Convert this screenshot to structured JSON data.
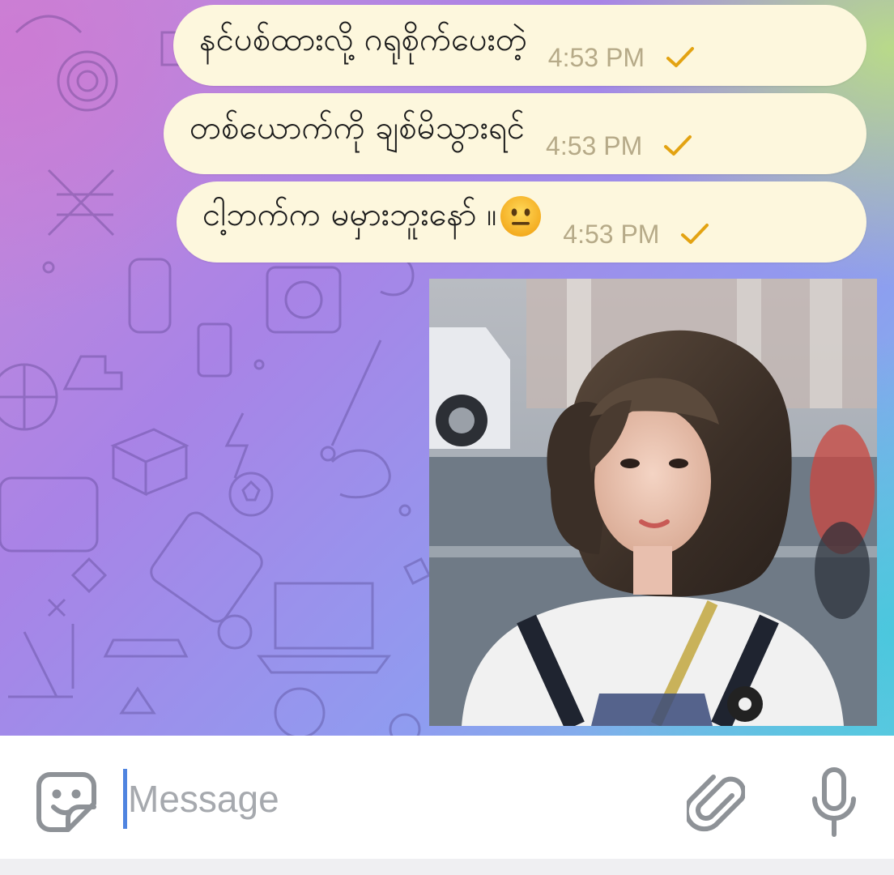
{
  "messages": [
    {
      "text": "နင်ပစ်ထားလို့ ဂရုစိုက်ပေးတဲ့",
      "time": "4:53 PM",
      "status_icon": "check-icon",
      "emoji": ""
    },
    {
      "text": "တစ်ယောက်ကို ချစ်မိသွားရင်",
      "time": "4:53 PM",
      "status_icon": "check-icon",
      "emoji": ""
    },
    {
      "text": "ငါ့ဘက်က မမှားဘူးနော် ။",
      "time": "4:53 PM",
      "status_icon": "check-icon",
      "emoji": "neutral-face-emoji"
    }
  ],
  "photo_message": {
    "icon": "photo-of-woman"
  },
  "composer": {
    "placeholder": "Message",
    "value": "",
    "sticker_icon": "sticker-icon",
    "attach_icon": "paperclip-icon",
    "mic_icon": "microphone-icon"
  },
  "colors": {
    "bubble_bg": "#fdf7dd",
    "time_text": "#b6aa88",
    "check": "#e3a312",
    "caret": "#4f84e0",
    "icon_gray": "#8e9297"
  }
}
